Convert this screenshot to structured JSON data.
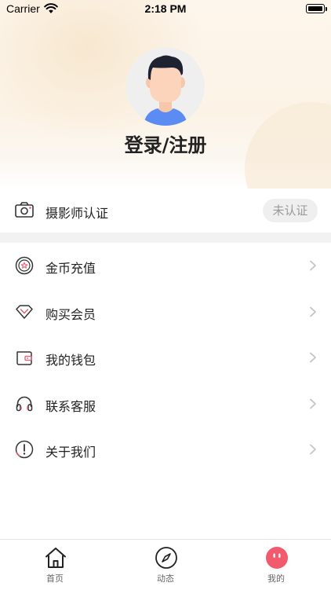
{
  "status_bar": {
    "carrier": "Carrier",
    "time": "2:18 PM"
  },
  "profile": {
    "login_title": "登录/注册"
  },
  "photographer": {
    "label": "摄影师认证",
    "badge": "未认证"
  },
  "menu": {
    "items": [
      {
        "label": "金币充值",
        "icon": "coin-icon"
      },
      {
        "label": "购买会员",
        "icon": "diamond-icon"
      },
      {
        "label": "我的钱包",
        "icon": "wallet-icon"
      },
      {
        "label": "联系客服",
        "icon": "headset-icon"
      },
      {
        "label": "关于我们",
        "icon": "info-icon"
      }
    ]
  },
  "tabbar": {
    "tabs": [
      {
        "label": "首页",
        "icon": "home-icon"
      },
      {
        "label": "动态",
        "icon": "compass-icon"
      },
      {
        "label": "我的",
        "icon": "face-icon",
        "active": true
      }
    ]
  },
  "colors": {
    "accent": "#f25a6e",
    "hero": "#fcf3e6",
    "band": "#f2f2f2"
  }
}
